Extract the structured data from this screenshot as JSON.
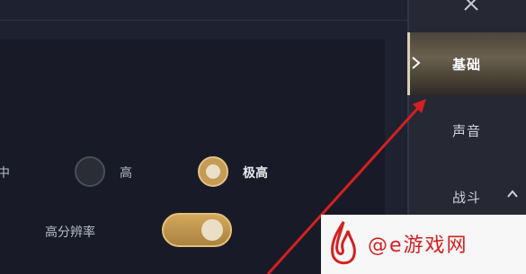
{
  "sidebar": {
    "tabs": [
      {
        "label": "基础",
        "active": true
      },
      {
        "label": "声音",
        "active": false
      },
      {
        "label": "战斗",
        "active": false
      }
    ]
  },
  "quality": {
    "options": [
      "中",
      "高",
      "极高"
    ],
    "selected": "极高"
  },
  "high_resolution": {
    "label": "高分辨率",
    "enabled": true
  },
  "watermark": {
    "text": "@e游戏网"
  },
  "colors": {
    "accent": "#c59b55",
    "annotation": "#d42020"
  }
}
